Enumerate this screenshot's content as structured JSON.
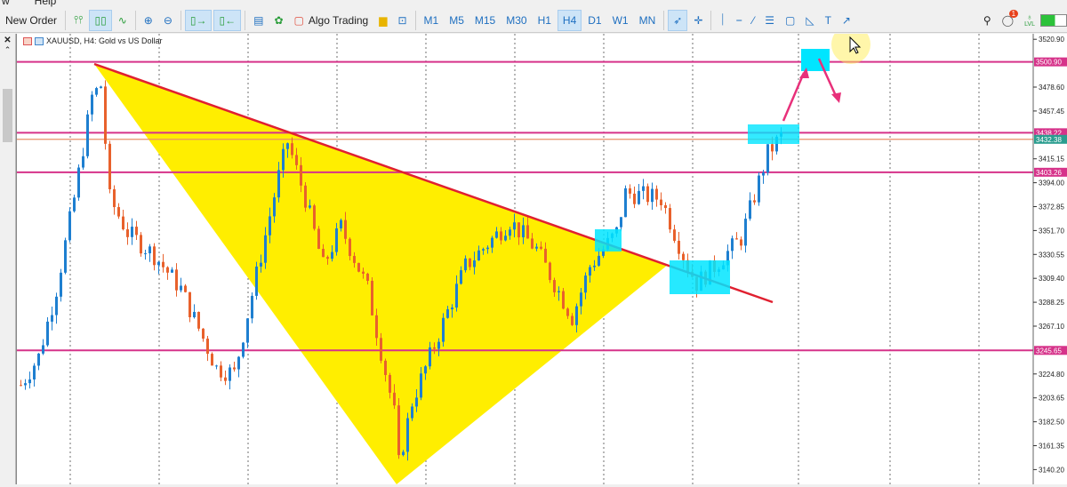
{
  "menu": {
    "items": [
      "w",
      "Help"
    ]
  },
  "toolbar": {
    "new_order": "New Order",
    "algo_trading": "Algo Trading",
    "timeframes": [
      "M1",
      "M5",
      "M15",
      "M30",
      "H1",
      "H4",
      "D1",
      "W1",
      "MN"
    ],
    "active_timeframe": "H4",
    "notifications": "1",
    "lvl": "LVL"
  },
  "chart_header": {
    "title": "XAUUSD, H4:  Gold vs US Dollar"
  },
  "chart_data": {
    "type": "candlestick",
    "symbol": "XAUUSD",
    "timeframe": "H4",
    "ylim": [
      3130,
      3525
    ],
    "y_ticks": [
      "3520.90",
      "3478.60",
      "3457.45",
      "3415.15",
      "3394.00",
      "3372.85",
      "3351.70",
      "3330.55",
      "3309.40",
      "3288.25",
      "3267.10",
      "3224.80",
      "3203.65",
      "3182.50",
      "3161.35",
      "3140.20"
    ],
    "levels": [
      {
        "price": "3500.90",
        "color": "#d6338a"
      },
      {
        "price": "3438.22",
        "color": "#d6338a"
      },
      {
        "price": "3432.38",
        "color": "#2a9d8f"
      },
      {
        "price": "3403.26",
        "color": "#d6338a"
      },
      {
        "price": "3245.65",
        "color": "#d6338a"
      }
    ],
    "price_path": [
      [
        0,
        3215
      ],
      [
        4,
        3240
      ],
      [
        8,
        3300
      ],
      [
        12,
        3380
      ],
      [
        16,
        3470
      ],
      [
        18,
        3480
      ],
      [
        20,
        3380
      ],
      [
        24,
        3350
      ],
      [
        30,
        3330
      ],
      [
        36,
        3300
      ],
      [
        44,
        3230
      ],
      [
        48,
        3225
      ],
      [
        54,
        3330
      ],
      [
        58,
        3400
      ],
      [
        60,
        3430
      ],
      [
        64,
        3380
      ],
      [
        68,
        3320
      ],
      [
        72,
        3355
      ],
      [
        78,
        3300
      ],
      [
        84,
        3190
      ],
      [
        85,
        3145
      ],
      [
        88,
        3200
      ],
      [
        92,
        3240
      ],
      [
        96,
        3280
      ],
      [
        100,
        3320
      ],
      [
        110,
        3360
      ],
      [
        116,
        3335
      ],
      [
        124,
        3275
      ],
      [
        128,
        3320
      ],
      [
        134,
        3350
      ],
      [
        136,
        3385
      ],
      [
        144,
        3380
      ],
      [
        150,
        3320
      ],
      [
        152,
        3305
      ],
      [
        156,
        3320
      ],
      [
        162,
        3345
      ],
      [
        168,
        3420
      ],
      [
        171,
        3435
      ]
    ],
    "colors": {
      "up": "#1e7fd0",
      "down": "#e8612c",
      "triangle": "#ffee00",
      "trendline": "#e02030",
      "box": "#00e5ff",
      "arrow": "#e8307a"
    }
  }
}
